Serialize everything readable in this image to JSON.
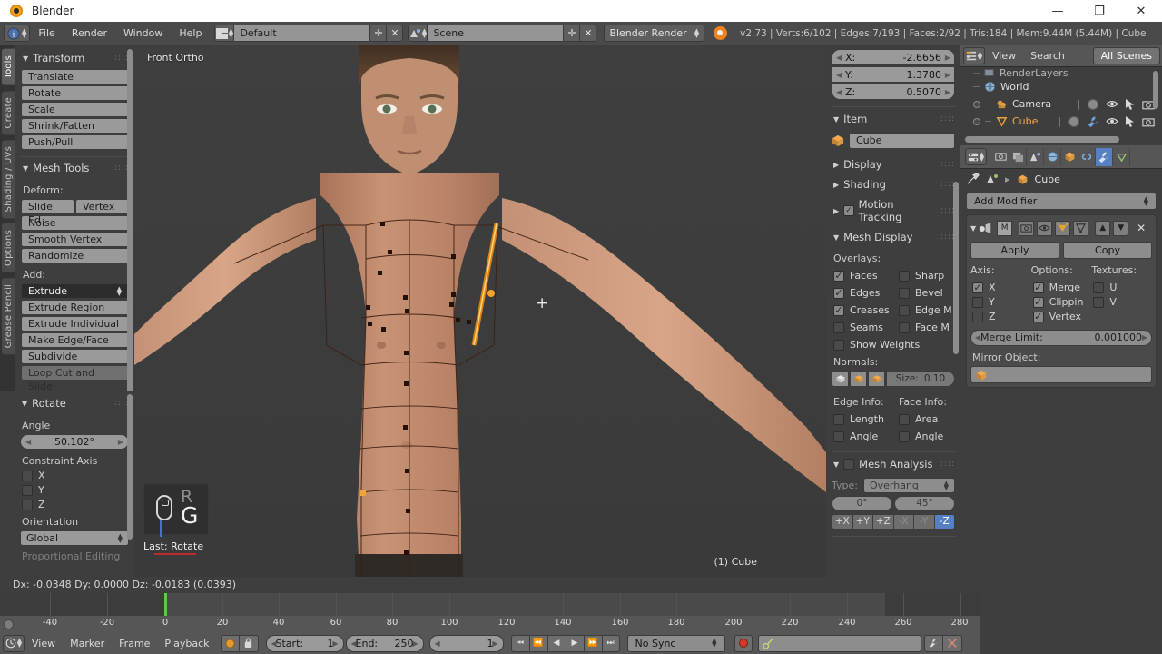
{
  "window": {
    "title": "Blender",
    "app_icon": "blender-logo-icon",
    "minimize": "—",
    "maximize": "❐",
    "close": "✕"
  },
  "topbar": {
    "editor_icon": "info-editor-icon",
    "menus": [
      "File",
      "Render",
      "Window",
      "Help"
    ],
    "screen_layout": {
      "icon": "screen-layout-icon",
      "value": "Default",
      "add": "✛",
      "remove": "✕"
    },
    "scene": {
      "icon": "scene-icon",
      "value": "Scene",
      "add": "✛",
      "remove": "✕"
    },
    "render_engine": "Blender Render",
    "status": "v2.73 | Verts:6/102 | Edges:7/193 | Faces:2/92 | Tris:184 | Mem:9.44M (5.44M) | Cube"
  },
  "toolshelf": {
    "tabs": [
      {
        "label": "Tools",
        "active": true
      },
      {
        "label": "Create",
        "active": false
      },
      {
        "label": "Shading / UVs",
        "active": false
      },
      {
        "label": "Options",
        "active": false
      },
      {
        "label": "Grease Pencil",
        "active": false
      }
    ],
    "transform": {
      "title": "Transform",
      "buttons": [
        "Translate",
        "Rotate",
        "Scale",
        "Shrink/Fatten",
        "Push/Pull"
      ]
    },
    "mesh_tools": {
      "title": "Mesh Tools",
      "deform_label": "Deform:",
      "deform_pair": [
        "Slide Ed",
        "Vertex"
      ],
      "deform_rest": [
        "Noise",
        "Smooth Vertex",
        "Randomize"
      ],
      "add_label": "Add:",
      "add_selected": "Extrude",
      "add_buttons": [
        "Extrude Region",
        "Extrude Individual",
        "Make Edge/Face",
        "Subdivide",
        "Loop Cut and Slide"
      ]
    },
    "rotate_panel": {
      "title": "Rotate",
      "angle_label": "Angle",
      "angle_value": "50.102°",
      "constraint_label": "Constraint Axis",
      "axes": [
        {
          "label": "X",
          "checked": false
        },
        {
          "label": "Y",
          "checked": false
        },
        {
          "label": "Z",
          "checked": false
        }
      ],
      "orientation_label": "Orientation",
      "orientation_value": "Global",
      "proportional_label": "Proportional Editing"
    }
  },
  "viewport": {
    "view_name": "Front Ortho",
    "object_label": "(1) Cube",
    "last_operator": "Last: Rotate",
    "keys": {
      "previous": "R",
      "current": "G",
      "mouse_icon": "mouse-icon"
    },
    "cursor": "+"
  },
  "npanel": {
    "median": [
      {
        "axis": "X:",
        "value": "-2.6656"
      },
      {
        "axis": "Y:",
        "value": "1.3780"
      },
      {
        "axis": "Z:",
        "value": "0.5070"
      }
    ],
    "item": {
      "title": "Item",
      "object_icon": "mesh-object-icon",
      "name": "Cube"
    },
    "display": "Display",
    "shading": "Shading",
    "motion_tracking": {
      "label": "Motion Tracking",
      "checked": true
    },
    "mesh_display": {
      "title": "Mesh Display",
      "overlays_label": "Overlays:",
      "overlays": [
        {
          "label": "Faces",
          "checked": true
        },
        {
          "label": "Sharp",
          "checked": false
        },
        {
          "label": "Edges",
          "checked": true
        },
        {
          "label": "Bevel",
          "checked": false
        },
        {
          "label": "Creases",
          "checked": true
        },
        {
          "label": "Edge M",
          "checked": false
        },
        {
          "label": "Seams",
          "checked": false
        },
        {
          "label": "Face M",
          "checked": false
        }
      ],
      "show_weights": {
        "label": "Show Weights",
        "checked": false
      },
      "normals_label": "Normals:",
      "normals_size_label": "Size:",
      "normals_size_value": "0.10",
      "edge_info_label": "Edge Info:",
      "face_info_label": "Face Info:",
      "edge_info": [
        {
          "label": "Length",
          "checked": false
        },
        {
          "label": "Angle",
          "checked": false
        }
      ],
      "face_info": [
        {
          "label": "Area",
          "checked": false
        },
        {
          "label": "Angle",
          "checked": false
        }
      ]
    },
    "mesh_analysis": {
      "title": "Mesh Analysis",
      "enabled": false,
      "type_label": "Type:",
      "type_value": "Overhang",
      "min_angle": "0°",
      "max_angle": "45°",
      "axis_buttons": [
        {
          "label": "+X",
          "active": false
        },
        {
          "label": "+Y",
          "active": false
        },
        {
          "label": "+Z",
          "active": false
        },
        {
          "label": "-X",
          "active": false
        },
        {
          "label": "-Y",
          "active": false
        },
        {
          "label": "-Z",
          "active": true
        }
      ]
    }
  },
  "outliner": {
    "editor_icon": "outliner-editor-icon",
    "menus": [
      "View",
      "Search"
    ],
    "scenes_filter": "All Scenes",
    "rows": [
      {
        "label": "RenderLayers",
        "icon": "renderlayers-icon",
        "partial": true
      },
      {
        "label": "World",
        "icon": "world-icon"
      },
      {
        "label": "Camera",
        "icon": "camera-data-icon"
      },
      {
        "label": "Cube",
        "icon": "mesh-triangle-icon"
      }
    ]
  },
  "properties": {
    "editor_icon": "properties-editor-icon",
    "tabs": [
      {
        "name": "render-tab",
        "active": false
      },
      {
        "name": "render-layers-tab",
        "active": false
      },
      {
        "name": "scene-tab",
        "active": false
      },
      {
        "name": "world-tab",
        "active": false
      },
      {
        "name": "object-tab",
        "active": false
      },
      {
        "name": "constraints-tab",
        "active": false
      },
      {
        "name": "modifiers-tab",
        "active": true
      },
      {
        "name": "data-tab",
        "active": false
      }
    ],
    "breadcrumb": {
      "pin": "pin-icon",
      "scene_icon": "scene-icon",
      "sep": "▸",
      "object": "Cube"
    },
    "add_modifier": "Add Modifier",
    "modifier": {
      "name_icon": "mirror-modifier-icon",
      "letter": "M",
      "apply": "Apply",
      "copy": "Copy",
      "close": "✕",
      "columns": {
        "axis": "Axis:",
        "options": "Options:",
        "textures": "Textures:"
      },
      "axis": [
        {
          "label": "X",
          "checked": true
        },
        {
          "label": "Y",
          "checked": false
        },
        {
          "label": "Z",
          "checked": false
        }
      ],
      "options": [
        {
          "label": "Merge",
          "checked": true
        },
        {
          "label": "Clippin",
          "checked": true
        },
        {
          "label": "Vertex",
          "checked": true
        }
      ],
      "textures": [
        {
          "label": "U",
          "checked": false
        },
        {
          "label": "V",
          "checked": false
        }
      ],
      "merge_limit_label": "Merge Limit:",
      "merge_limit_value": "0.001000",
      "mirror_object_label": "Mirror Object:",
      "mirror_object_value": ""
    }
  },
  "statusline": "Dx: -0.0348  Dy: 0.0000  Dz: -0.0183 (0.0393)",
  "timeline": {
    "editor_icon": "timeline-editor-icon",
    "menus": [
      "View",
      "Marker",
      "Frame",
      "Playback"
    ],
    "toggle_icons": [
      "autokey-icon",
      "lock-icon"
    ],
    "start_label": "Start:",
    "start_value": "1",
    "end_label": "End:",
    "end_value": "250",
    "current_frame": "1",
    "transport": [
      "⏮",
      "⏪",
      "◀",
      "▶",
      "⏩",
      "⏭"
    ],
    "sync_mode": "No Sync",
    "record_icon": "record-icon",
    "keying_set_icon": "keyingset-icon",
    "keying_value": "",
    "add_key_icon": "wrench-icon",
    "remove_key_icon": "scissors-icon",
    "ticks": [
      "-40",
      "-20",
      "0",
      "20",
      "40",
      "60",
      "80",
      "100",
      "120",
      "140",
      "160",
      "180",
      "200",
      "220",
      "240",
      "260",
      "280"
    ],
    "frame_range": {
      "min": -48,
      "max": 288,
      "start": 1,
      "end": 250,
      "current": 1
    }
  },
  "colors": {
    "accent_blue": "#5680c2",
    "header_gray": "#565656",
    "panel_gray": "#3e3e3e",
    "button_gray": "#9a9a9a",
    "playhead_green": "#68c34a",
    "record_red": "#cf3b2a",
    "selection_orange": "#f2a33c"
  }
}
